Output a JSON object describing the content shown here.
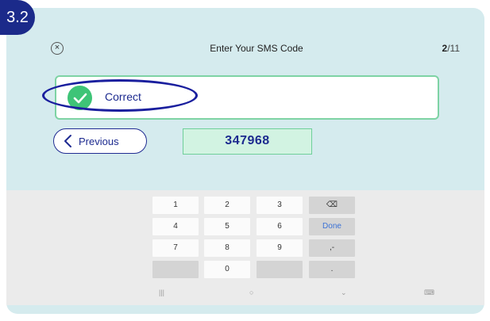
{
  "step_badge": "3.2",
  "header": {
    "close_icon": "×",
    "title": "Enter Your SMS Code",
    "counter_current": "2",
    "counter_total": "/11"
  },
  "status": {
    "icon": "check-icon",
    "label": "Correct"
  },
  "previous_button": {
    "label": "Previous",
    "icon": "chevron-left-icon"
  },
  "code_field": {
    "value": "347968"
  },
  "keypad": {
    "row1": [
      "1",
      "2",
      "3",
      "⌫"
    ],
    "row2": [
      "4",
      "5",
      "6",
      "Done"
    ],
    "row3": [
      "7",
      "8",
      "9",
      ",-"
    ],
    "row4": [
      "",
      "0",
      "",
      "."
    ]
  },
  "nav_bar": {
    "recent": "|||",
    "home": "○",
    "back": "⌄",
    "keyboard": "⌨"
  },
  "colors": {
    "badge": "#1b2a8a",
    "panel": "#d5ebee",
    "success": "#3ec477",
    "accent": "#1c2a8f",
    "annotation": "#1a1f9e"
  }
}
